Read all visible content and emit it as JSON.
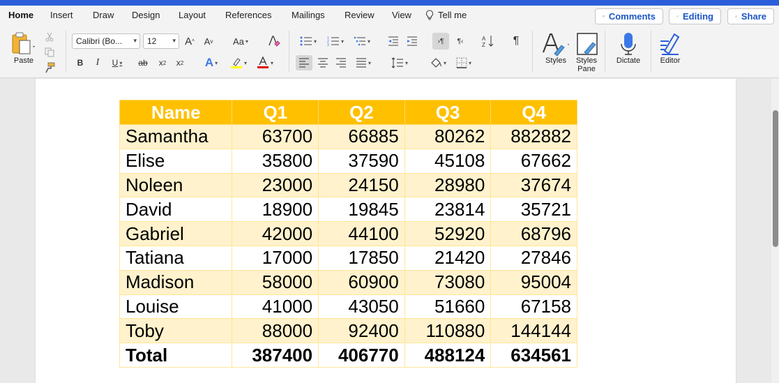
{
  "tabs": [
    "Home",
    "Insert",
    "Draw",
    "Design",
    "Layout",
    "References",
    "Mailings",
    "Review",
    "View"
  ],
  "tell_me": "Tell me",
  "top_buttons": {
    "comments": "Comments",
    "editing": "Editing",
    "share": "Share"
  },
  "ribbon": {
    "paste_label": "Paste",
    "font_name": "Calibri (Bo...",
    "font_size": "12",
    "styles_label": "Styles",
    "styles_pane_label_1": "Styles",
    "styles_pane_label_2": "Pane",
    "dictate_label": "Dictate",
    "editor_label": "Editor",
    "bold": "B",
    "italic": "I",
    "underline": "U",
    "strike": "ab",
    "subscript": "x",
    "superscript": "x",
    "font_case": "Aa",
    "grow_font": "A",
    "shrink_font": "A",
    "pilcrow": "¶"
  },
  "colors": {
    "accent": "#2b5fd9",
    "header_fill": "#ffc000",
    "band_fill": "#fff2cc",
    "highlight": "#ffff00",
    "font_color": "#e00000"
  },
  "table": {
    "headers": [
      "Name",
      "Q1",
      "Q2",
      "Q3",
      "Q4"
    ],
    "rows": [
      [
        "Samantha",
        "63700",
        "66885",
        "80262",
        "882882"
      ],
      [
        "Elise",
        "35800",
        "37590",
        "45108",
        "67662"
      ],
      [
        "Noleen",
        "23000",
        "24150",
        "28980",
        "37674"
      ],
      [
        "David",
        "18900",
        "19845",
        "23814",
        "35721"
      ],
      [
        "Gabriel",
        "42000",
        "44100",
        "52920",
        "68796"
      ],
      [
        "Tatiana",
        "17000",
        "17850",
        "21420",
        "27846"
      ],
      [
        "Madison",
        "58000",
        "60900",
        "73080",
        "95004"
      ],
      [
        "Louise",
        "41000",
        "43050",
        "51660",
        "67158"
      ],
      [
        "Toby",
        "88000",
        "92400",
        "110880",
        "144144"
      ]
    ],
    "total": [
      "Total",
      "387400",
      "406770",
      "488124",
      "634561"
    ]
  }
}
